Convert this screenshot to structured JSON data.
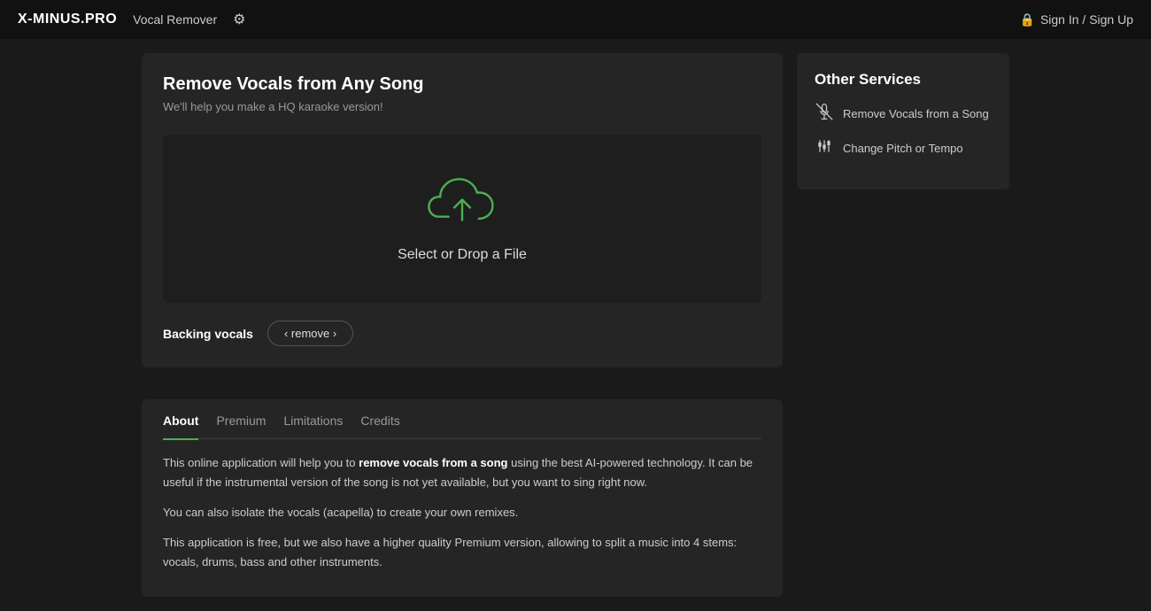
{
  "header": {
    "brand": "X-MINUS.PRO",
    "nav_item": "Vocal Remover",
    "sign_in": "Sign In / Sign Up"
  },
  "main_panel": {
    "title": "Remove Vocals from Any Song",
    "subtitle": "We'll help you make a HQ karaoke version!",
    "upload_text": "Select or Drop a File",
    "backing_vocals_label": "Backing vocals",
    "remove_button": "‹ remove ›"
  },
  "tabs": {
    "items": [
      {
        "id": "about",
        "label": "About",
        "active": true
      },
      {
        "id": "premium",
        "label": "Premium",
        "active": false
      },
      {
        "id": "limitations",
        "label": "Limitations",
        "active": false
      },
      {
        "id": "credits",
        "label": "Credits",
        "active": false
      }
    ],
    "about_content": {
      "paragraph1_pre": "This online application will help you to ",
      "paragraph1_bold": "remove vocals from a song",
      "paragraph1_post": " using the best AI-powered technology. It can be useful if the instrumental version of the song is not yet available, but you want to sing right now.",
      "paragraph2": "You can also isolate the vocals (acapella) to create your own remixes.",
      "paragraph3": "This application is free, but we also have a higher quality Premium version, allowing to split a music into 4 stems: vocals, drums, bass and other instruments."
    }
  },
  "right_panel": {
    "title": "Other Services",
    "services": [
      {
        "id": "remove-vocals",
        "label": "Remove Vocals from a Song",
        "icon": "mic_off"
      },
      {
        "id": "change-pitch",
        "label": "Change Pitch or Tempo",
        "icon": "equalizer"
      }
    ]
  }
}
